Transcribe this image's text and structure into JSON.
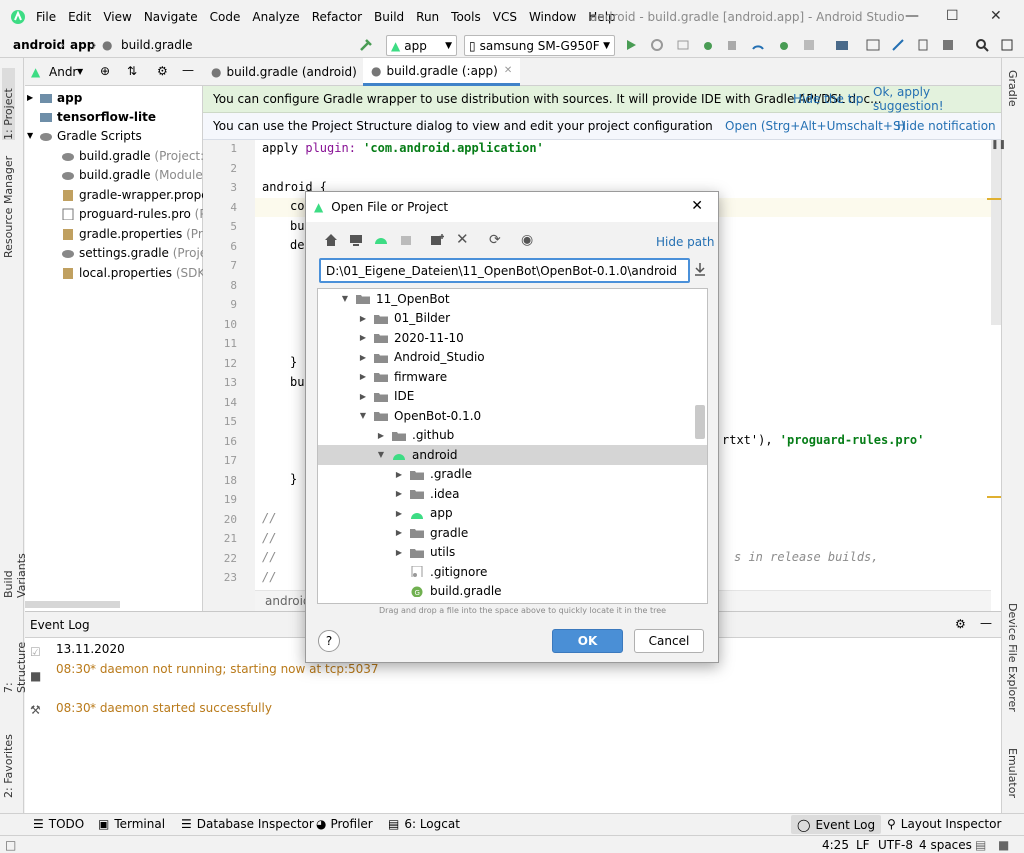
{
  "window": {
    "title": "android - build.gradle [android.app] - Android Studio"
  },
  "menu": [
    "File",
    "Edit",
    "View",
    "Navigate",
    "Code",
    "Analyze",
    "Refactor",
    "Build",
    "Run",
    "Tools",
    "VCS",
    "Window",
    "Help"
  ],
  "nav": {
    "crumbs": [
      "android",
      "app",
      "build.gradle"
    ],
    "run_config": "app",
    "device": "samsung SM-G950F"
  },
  "left_tabs": [
    "1: Project",
    "Resource Manager",
    "Build Variants",
    "7: Structure",
    "2: Favorites"
  ],
  "right_tabs": [
    "Gradle",
    "Device File Explorer",
    "Emulator"
  ],
  "project": {
    "header": "Andr",
    "items": [
      {
        "name": "app",
        "bold": true,
        "note": ""
      },
      {
        "name": "tensorflow-lite",
        "bold": true,
        "note": ""
      },
      {
        "name": "Gradle Scripts",
        "bold": false,
        "note": ""
      },
      {
        "name": "build.gradle",
        "note": "(Project: an"
      },
      {
        "name": "build.gradle",
        "note": "(Module: ar"
      },
      {
        "name": "gradle-wrapper.properti",
        "note": ""
      },
      {
        "name": "proguard-rules.pro",
        "note": "(Pro"
      },
      {
        "name": "gradle.properties",
        "note": "(Projec"
      },
      {
        "name": "settings.gradle",
        "note": "(Project S"
      },
      {
        "name": "local.properties",
        "note": "(SDK Lo"
      }
    ]
  },
  "editor": {
    "tabs": [
      "build.gradle (android)",
      "build.gradle (:app)"
    ],
    "banner1": {
      "text": "You can configure Gradle wrapper to use distribution with sources. It will provide IDE with Gradle API/DSL doc...",
      "link1": "Hide the tip",
      "link2": "Ok, apply suggestion!"
    },
    "banner2": {
      "text": "You can use the Project Structure dialog to view and edit your project configuration",
      "link1": "Open (Strg+Alt+Umschalt+S)",
      "link2": "Hide notification"
    },
    "line_numbers": [
      "1",
      "2",
      "3",
      "4",
      "5",
      "6",
      "7",
      "8",
      "9",
      "10",
      "11",
      "12",
      "13",
      "14",
      "15",
      "16",
      "17",
      "18",
      "19",
      "20",
      "21",
      "22",
      "23"
    ],
    "code": {
      "l1a": "apply ",
      "l1b": "plugin: ",
      "l1c": "'com.android.application'",
      "l3": "android {",
      "l4": "co",
      "l5": "bu",
      "l6": "de",
      "l12": "}",
      "l13": "bu",
      "l16a": "rtxt'), ",
      "l16b": "'proguard-rules.pro'",
      "l18": "}",
      "l20": "//",
      "l21": "//",
      "l22": "//",
      "l22b": "s in release builds,",
      "l23": "//",
      "footer": "android"
    }
  },
  "eventlog": {
    "title": "Event Log",
    "date": "13.11.2020",
    "entries": [
      {
        "time": "08:30",
        "msg": "* daemon not running; starting now at tcp:5037"
      },
      {
        "time": "08:30",
        "msg": "* daemon started successfully"
      }
    ]
  },
  "bottom_tabs": [
    "TODO",
    "Terminal",
    "Database Inspector",
    "Profiler",
    "6: Logcat"
  ],
  "bottom_right_tabs": [
    "Event Log",
    "Layout Inspector"
  ],
  "status": {
    "pos": "4:25",
    "le": "LF",
    "enc": "UTF-8",
    "indent": "4 spaces"
  },
  "dialog": {
    "title": "Open File or Project",
    "hide_path": "Hide path",
    "path": "D:\\01_Eigene_Dateien\\11_OpenBot\\OpenBot-0.1.0\\android",
    "tree": [
      {
        "label": "11_OpenBot",
        "depth": 0,
        "expanded": true,
        "type": "folder"
      },
      {
        "label": "01_Bilder",
        "depth": 1,
        "expanded": false,
        "type": "folder"
      },
      {
        "label": "2020-11-10",
        "depth": 1,
        "expanded": false,
        "type": "folder"
      },
      {
        "label": "Android_Studio",
        "depth": 1,
        "expanded": false,
        "type": "folder"
      },
      {
        "label": "firmware",
        "depth": 1,
        "expanded": false,
        "type": "folder"
      },
      {
        "label": "IDE",
        "depth": 1,
        "expanded": false,
        "type": "folder"
      },
      {
        "label": "OpenBot-0.1.0",
        "depth": 1,
        "expanded": true,
        "type": "folder"
      },
      {
        "label": ".github",
        "depth": 2,
        "expanded": false,
        "type": "folder"
      },
      {
        "label": "android",
        "depth": 2,
        "expanded": true,
        "type": "android",
        "selected": true
      },
      {
        "label": ".gradle",
        "depth": 3,
        "expanded": false,
        "type": "folder"
      },
      {
        "label": ".idea",
        "depth": 3,
        "expanded": false,
        "type": "folder"
      },
      {
        "label": "app",
        "depth": 3,
        "expanded": false,
        "type": "android"
      },
      {
        "label": "gradle",
        "depth": 3,
        "expanded": false,
        "type": "folder"
      },
      {
        "label": "utils",
        "depth": 3,
        "expanded": false,
        "type": "folder"
      },
      {
        "label": ".gitignore",
        "depth": 3,
        "leaf": true,
        "type": "file"
      },
      {
        "label": "build.gradle",
        "depth": 3,
        "leaf": true,
        "type": "gradle"
      }
    ],
    "hint": "Drag and drop a file into the space above to quickly locate it in the tree",
    "help": "?",
    "ok": "OK",
    "cancel": "Cancel"
  }
}
